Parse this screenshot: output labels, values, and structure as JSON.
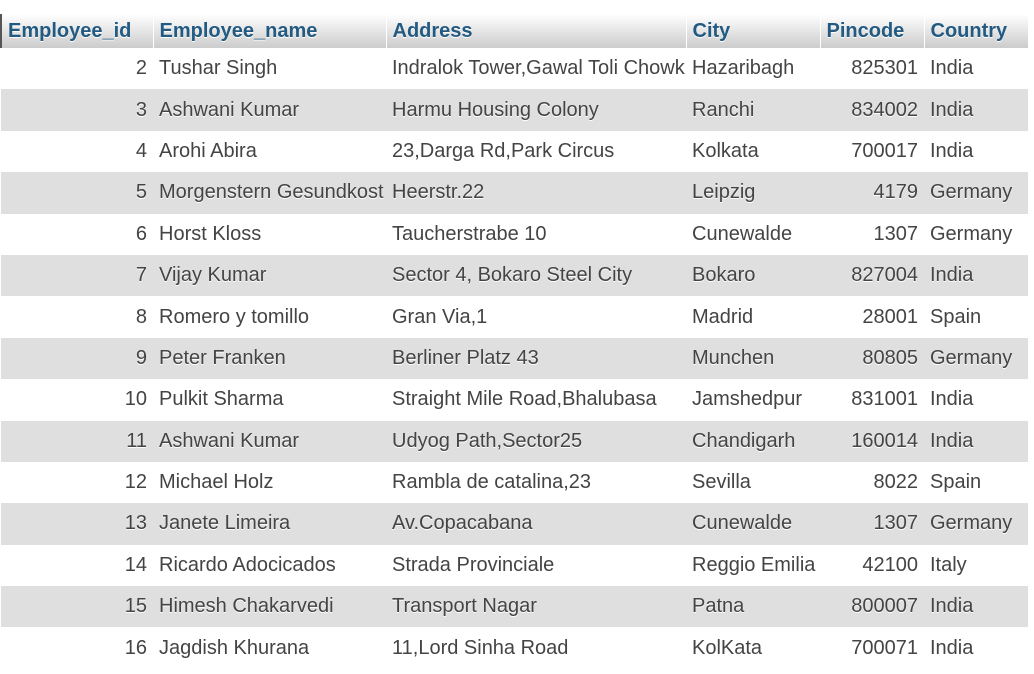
{
  "table": {
    "columns": [
      "Employee_id",
      "Employee_name",
      "Address",
      "City",
      "Pincode",
      "Country"
    ],
    "rows": [
      [
        "2",
        "Tushar Singh",
        "Indralok Tower,Gawal Toli Chowk",
        "Hazaribagh",
        "825301",
        "India"
      ],
      [
        "3",
        "Ashwani Kumar",
        "Harmu Housing Colony",
        "Ranchi",
        "834002",
        "India"
      ],
      [
        "4",
        "Arohi Abira",
        "23,Darga Rd,Park Circus",
        "Kolkata",
        "700017",
        "India"
      ],
      [
        "5",
        "Morgenstern Gesundkost",
        "Heerstr.22",
        "Leipzig",
        "4179",
        "Germany"
      ],
      [
        "6",
        "Horst Kloss",
        "Taucherstrabe 10",
        "Cunewalde",
        "1307",
        "Germany"
      ],
      [
        "7",
        "Vijay Kumar",
        "Sector 4, Bokaro Steel City",
        "Bokaro",
        "827004",
        "India"
      ],
      [
        "8",
        "Romero y tomillo",
        "Gran Via,1",
        "Madrid",
        "28001",
        "Spain"
      ],
      [
        "9",
        "Peter Franken",
        "Berliner Platz 43",
        "Munchen",
        "80805",
        "Germany"
      ],
      [
        "10",
        "Pulkit Sharma",
        "Straight Mile Road,Bhalubasa",
        "Jamshedpur",
        "831001",
        "India"
      ],
      [
        "11",
        "Ashwani Kumar",
        "Udyog Path,Sector25",
        "Chandigarh",
        "160014",
        "India"
      ],
      [
        "12",
        "Michael Holz",
        "Rambla de catalina,23",
        "Sevilla",
        "8022",
        "Spain"
      ],
      [
        "13",
        "Janete Limeira",
        "Av.Copacabana",
        "Cunewalde",
        "1307",
        "Germany"
      ],
      [
        "14",
        "Ricardo Adocicados",
        "Strada Provinciale",
        "Reggio Emilia",
        "42100",
        "Italy"
      ],
      [
        "15",
        "Himesh Chakarvedi",
        "Transport Nagar",
        "Patna",
        "800007",
        "India"
      ],
      [
        "16",
        "Jagdish Khurana",
        "11,Lord Sinha Road",
        "KolKata",
        "700071",
        "India"
      ]
    ]
  },
  "colors": {
    "header_text": "#235a81",
    "row_alt_bg": "#dfdfdf",
    "cell_text": "#444444"
  }
}
